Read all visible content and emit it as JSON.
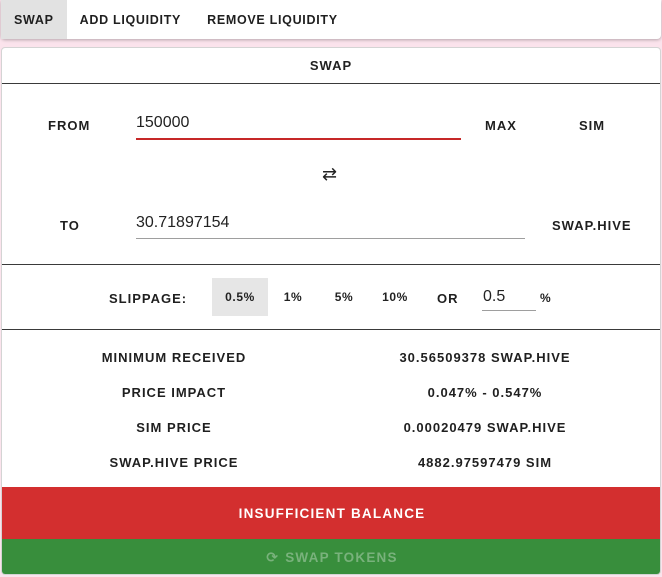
{
  "tabs": [
    {
      "label": "SWAP",
      "active": true
    },
    {
      "label": "ADD LIQUIDITY",
      "active": false
    },
    {
      "label": "REMOVE LIQUIDITY",
      "active": false
    }
  ],
  "card": {
    "title": "SWAP"
  },
  "from": {
    "label": "FROM",
    "value": "150000",
    "max_label": "MAX",
    "token": "SIM"
  },
  "swap_icon": "swap-horizontal-arrows-icon",
  "to": {
    "label": "TO",
    "value": "30.71897154",
    "token": "SWAP.HIVE"
  },
  "slippage": {
    "label": "SLIPPAGE:",
    "options": [
      "0.5%",
      "1%",
      "5%",
      "10%"
    ],
    "selected": "0.5%",
    "or_label": "OR",
    "custom_value": "0.5",
    "unit": "%"
  },
  "details": [
    {
      "label": "MINIMUM RECEIVED",
      "value": "30.56509378 SWAP.HIVE"
    },
    {
      "label": "PRICE IMPACT",
      "value": "0.047% - 0.547%"
    },
    {
      "label": "SIM PRICE",
      "value": "0.00020479 SWAP.HIVE"
    },
    {
      "label": "SWAP.HIVE PRICE",
      "value": "4882.97597479 SIM"
    }
  ],
  "buttons": {
    "insufficient": "INSUFFICIENT BALANCE",
    "swap_tokens": "SWAP TOKENS",
    "swap_tokens_icon": "refresh-icon"
  },
  "colors": {
    "error_red": "#d32f2f",
    "input_error_underline": "#c62828",
    "success_green": "#388e3c",
    "page_bg": "#fbe3ec"
  }
}
